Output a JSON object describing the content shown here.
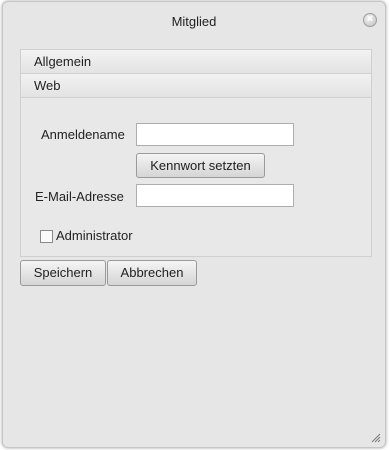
{
  "window": {
    "title": "Mitglied",
    "close_glyph": "×"
  },
  "accordion": {
    "sections": [
      {
        "label": "Allgemein"
      },
      {
        "label": "Web"
      }
    ]
  },
  "form": {
    "username_label": "Anmeldename",
    "username_value": "",
    "set_password_label": "Kennwort setzten",
    "email_label": "E-Mail-Adresse",
    "email_value": "",
    "admin_label": "Administrator",
    "admin_checked": false
  },
  "actions": {
    "save_label": "Speichern",
    "cancel_label": "Abbrechen"
  },
  "icons": {
    "close": "close-icon",
    "resize": "resize-grip-icon"
  }
}
